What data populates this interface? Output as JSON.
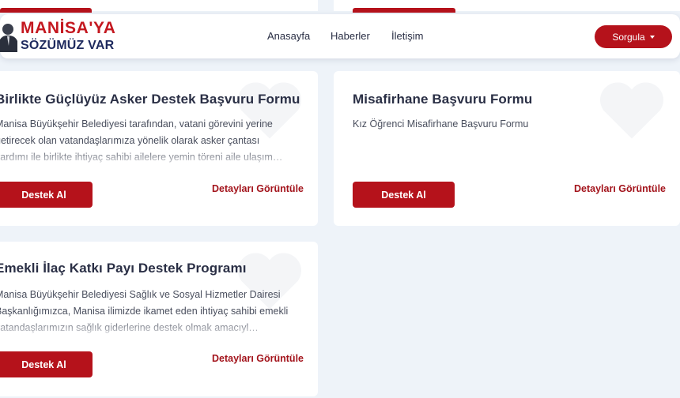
{
  "brand": {
    "line1": "MANİSA'YA",
    "line2": "SÖZÜMÜZ VAR"
  },
  "nav": {
    "items": [
      "Anasayfa",
      "Haberler",
      "İletişim"
    ],
    "dropdown_label": "Sorgula"
  },
  "cards": [
    {
      "title": "Birlikte Güçlüyüz Asker Destek Başvuru Formu",
      "description": "Manisa Büyükşehir Belediyesi tarafından, vatani görevini yerine getirecek olan vatandaşlarımıza yönelik olarak asker çantası yardımı ile birlikte ihtiyaç sahibi ailelere yemin töreni aile ulaşım…",
      "button": "Destek Al",
      "link": "Detayları Görüntüle"
    },
    {
      "title": "Misafirhane Başvuru Formu",
      "description": "Kız Öğrenci Misafirhane Başvuru Formu",
      "button": "Destek Al",
      "link": "Detayları Görüntüle"
    },
    {
      "title": "Emekli İlaç Katkı Payı Destek Programı",
      "description": "Manisa Büyükşehir Belediyesi Sağlık ve Sosyal Hizmetler Dairesi Başkanlığımızca, Manisa ilimizde ikamet eden ihtiyaç sahibi emekli vatandaşlarımızın sağlık giderlerine destek olmak amacıyl…",
      "button": "Destek Al",
      "link": "Detayları Görüntüle"
    }
  ],
  "colors": {
    "accent": "#b5121b",
    "brand_red": "#c41820",
    "brand_navy": "#1e2a5e",
    "background": "#eef3f9"
  }
}
